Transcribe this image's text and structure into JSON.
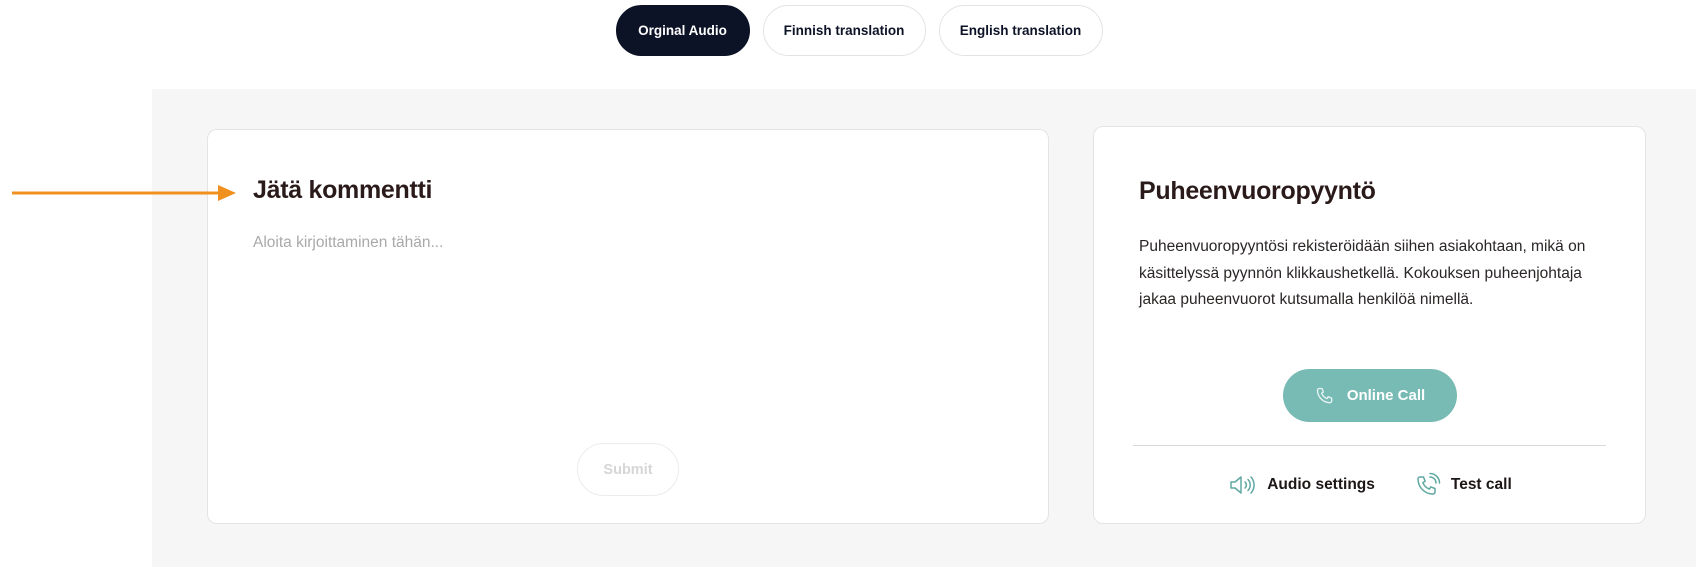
{
  "tabs": [
    {
      "label": "Orginal Audio",
      "active": true
    },
    {
      "label": "Finnish translation",
      "active": false
    },
    {
      "label": "English translation",
      "active": false
    }
  ],
  "comment": {
    "title": "Jätä kommentti",
    "placeholder": "Aloita kirjoittaminen tähän...",
    "value": "",
    "submit_label": "Submit"
  },
  "request": {
    "title": "Puheenvuoropyyntö",
    "description": "Puheenvuoropyyntösi rekisteröidään siihen asiakohtaan, mikä on käsittelyssä pyynnön klikkaushetkellä. Kokouksen puheenjohtaja jakaa puheenvuorot kutsumalla henkilöä nimellä.",
    "call_button_label": "Online Call",
    "audio_settings_label": "Audio settings",
    "test_call_label": "Test call"
  },
  "icons": {
    "call_button": "phone-icon",
    "audio_settings": "speaker-icon",
    "test_call": "phone-ringing-icon",
    "annotation": "arrow-right-icon"
  },
  "colors": {
    "active_tab": "#0d1326",
    "call_button": "#78bab4",
    "icon_accent": "#5ea8a2",
    "annotation_arrow": "#f0901e",
    "panel_background": "#f6f6f6"
  }
}
